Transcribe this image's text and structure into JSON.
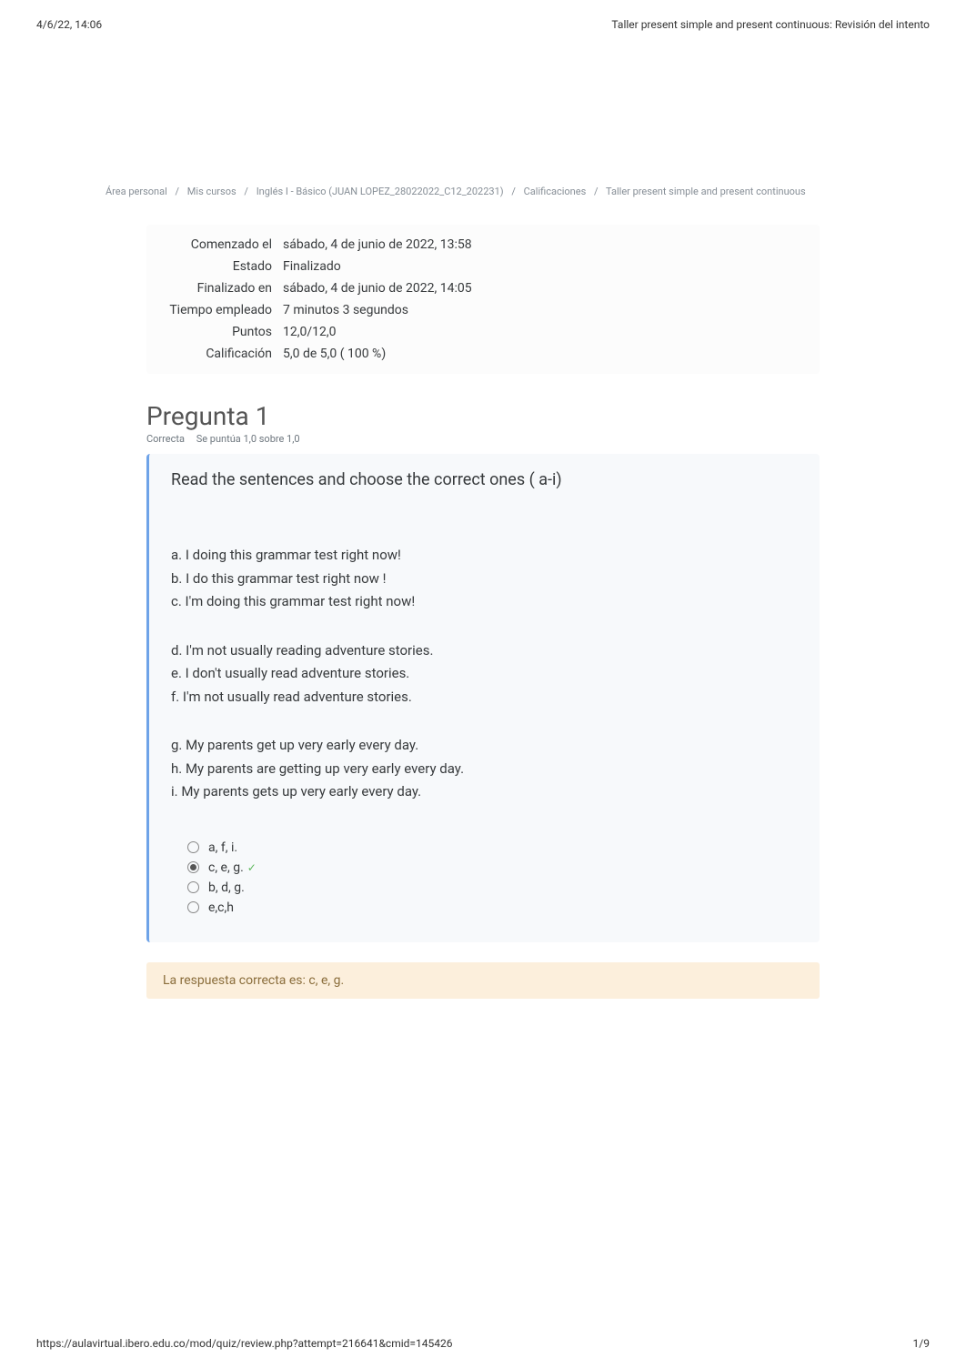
{
  "header": {
    "timestamp": "4/6/22, 14:06",
    "doc_title": "Taller present simple and present continuous: Revisión del intento"
  },
  "breadcrumb": {
    "items": [
      {
        "label": "Área personal"
      },
      {
        "label": "Mis cursos"
      },
      {
        "label": "Inglés I - Básico (JUAN LOPEZ_28022022_C12_202231)"
      },
      {
        "label": "Calificaciones"
      },
      {
        "label": "Taller present simple and present continuous"
      }
    ]
  },
  "summary": {
    "rows": [
      {
        "label": "Comenzado el",
        "value": "sábado, 4 de junio de 2022, 13:58"
      },
      {
        "label": "Estado",
        "value": "Finalizado"
      },
      {
        "label": "Finalizado en",
        "value": "sábado, 4 de junio de 2022, 14:05"
      },
      {
        "label": "Tiempo empleado",
        "value": "7 minutos 3 segundos"
      },
      {
        "label": "Puntos",
        "value": "12,0/12,0"
      },
      {
        "label": "Calificación",
        "value": "5,0  de 5,0 ( 100 %)"
      }
    ]
  },
  "question": {
    "title": "Pregunta 1",
    "status": "Correcta",
    "score": "Se puntúa 1,0 sobre 1,0",
    "prompt": "Read the sentences and choose the correct ones ( a-i)",
    "lines": {
      "a": " a. I doing this grammar test right now!",
      "b": " b. I do this grammar test right now !",
      "c": " c.   I'm doing this grammar test right now!",
      "d": "d. I'm not usually reading adventure stories.",
      "e": "e. I don't usually read adventure stories.",
      "f": "f.   I'm not usually read adventure stories.",
      "g": "g. My parents get up very early every day.",
      "h": "h. My parents are getting up very early every day.",
      "i": " i. My parents gets up very early every day."
    },
    "options": [
      {
        "label": "a, f, i.",
        "checked": false,
        "correct": false
      },
      {
        "label": "c, e, g.",
        "checked": true,
        "correct": true
      },
      {
        "label": "b, d, g.",
        "checked": false,
        "correct": false
      },
      {
        "label": "e,c,h",
        "checked": false,
        "correct": false
      }
    ]
  },
  "feedback": {
    "text": "La respuesta correcta es: c, e, g."
  },
  "footer": {
    "url": "https://aulavirtual.ibero.edu.co/mod/quiz/review.php?attempt=216641&cmid=145426",
    "page": "1/9"
  }
}
